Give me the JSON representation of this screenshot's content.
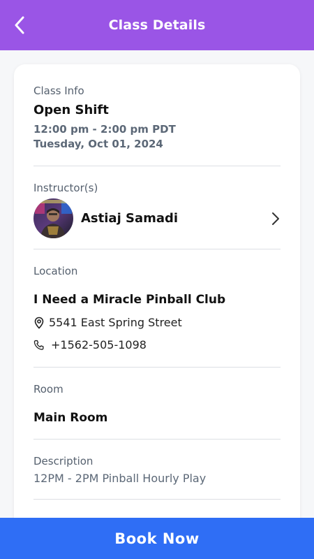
{
  "header": {
    "title": "Class Details"
  },
  "class_info": {
    "label": "Class Info",
    "name": "Open Shift",
    "time": "12:00 pm - 2:00 pm PDT",
    "date": "Tuesday, Oct 01, 2024"
  },
  "instructors": {
    "label": "Instructor(s)",
    "items": [
      {
        "name": "Astiaj Samadi"
      }
    ]
  },
  "location": {
    "label": "Location",
    "name": "I Need a Miracle Pinball Club",
    "address": "5541 East Spring Street",
    "phone": "+1562-505-1098"
  },
  "room": {
    "label": "Room",
    "name": "Main Room"
  },
  "description": {
    "label": "Description",
    "text": "12PM - 2PM Pinball Hourly Play"
  },
  "footer": {
    "book_label": "Book Now"
  },
  "colors": {
    "header_bg": "#9a55e6",
    "primary_button": "#2f6ef5"
  }
}
